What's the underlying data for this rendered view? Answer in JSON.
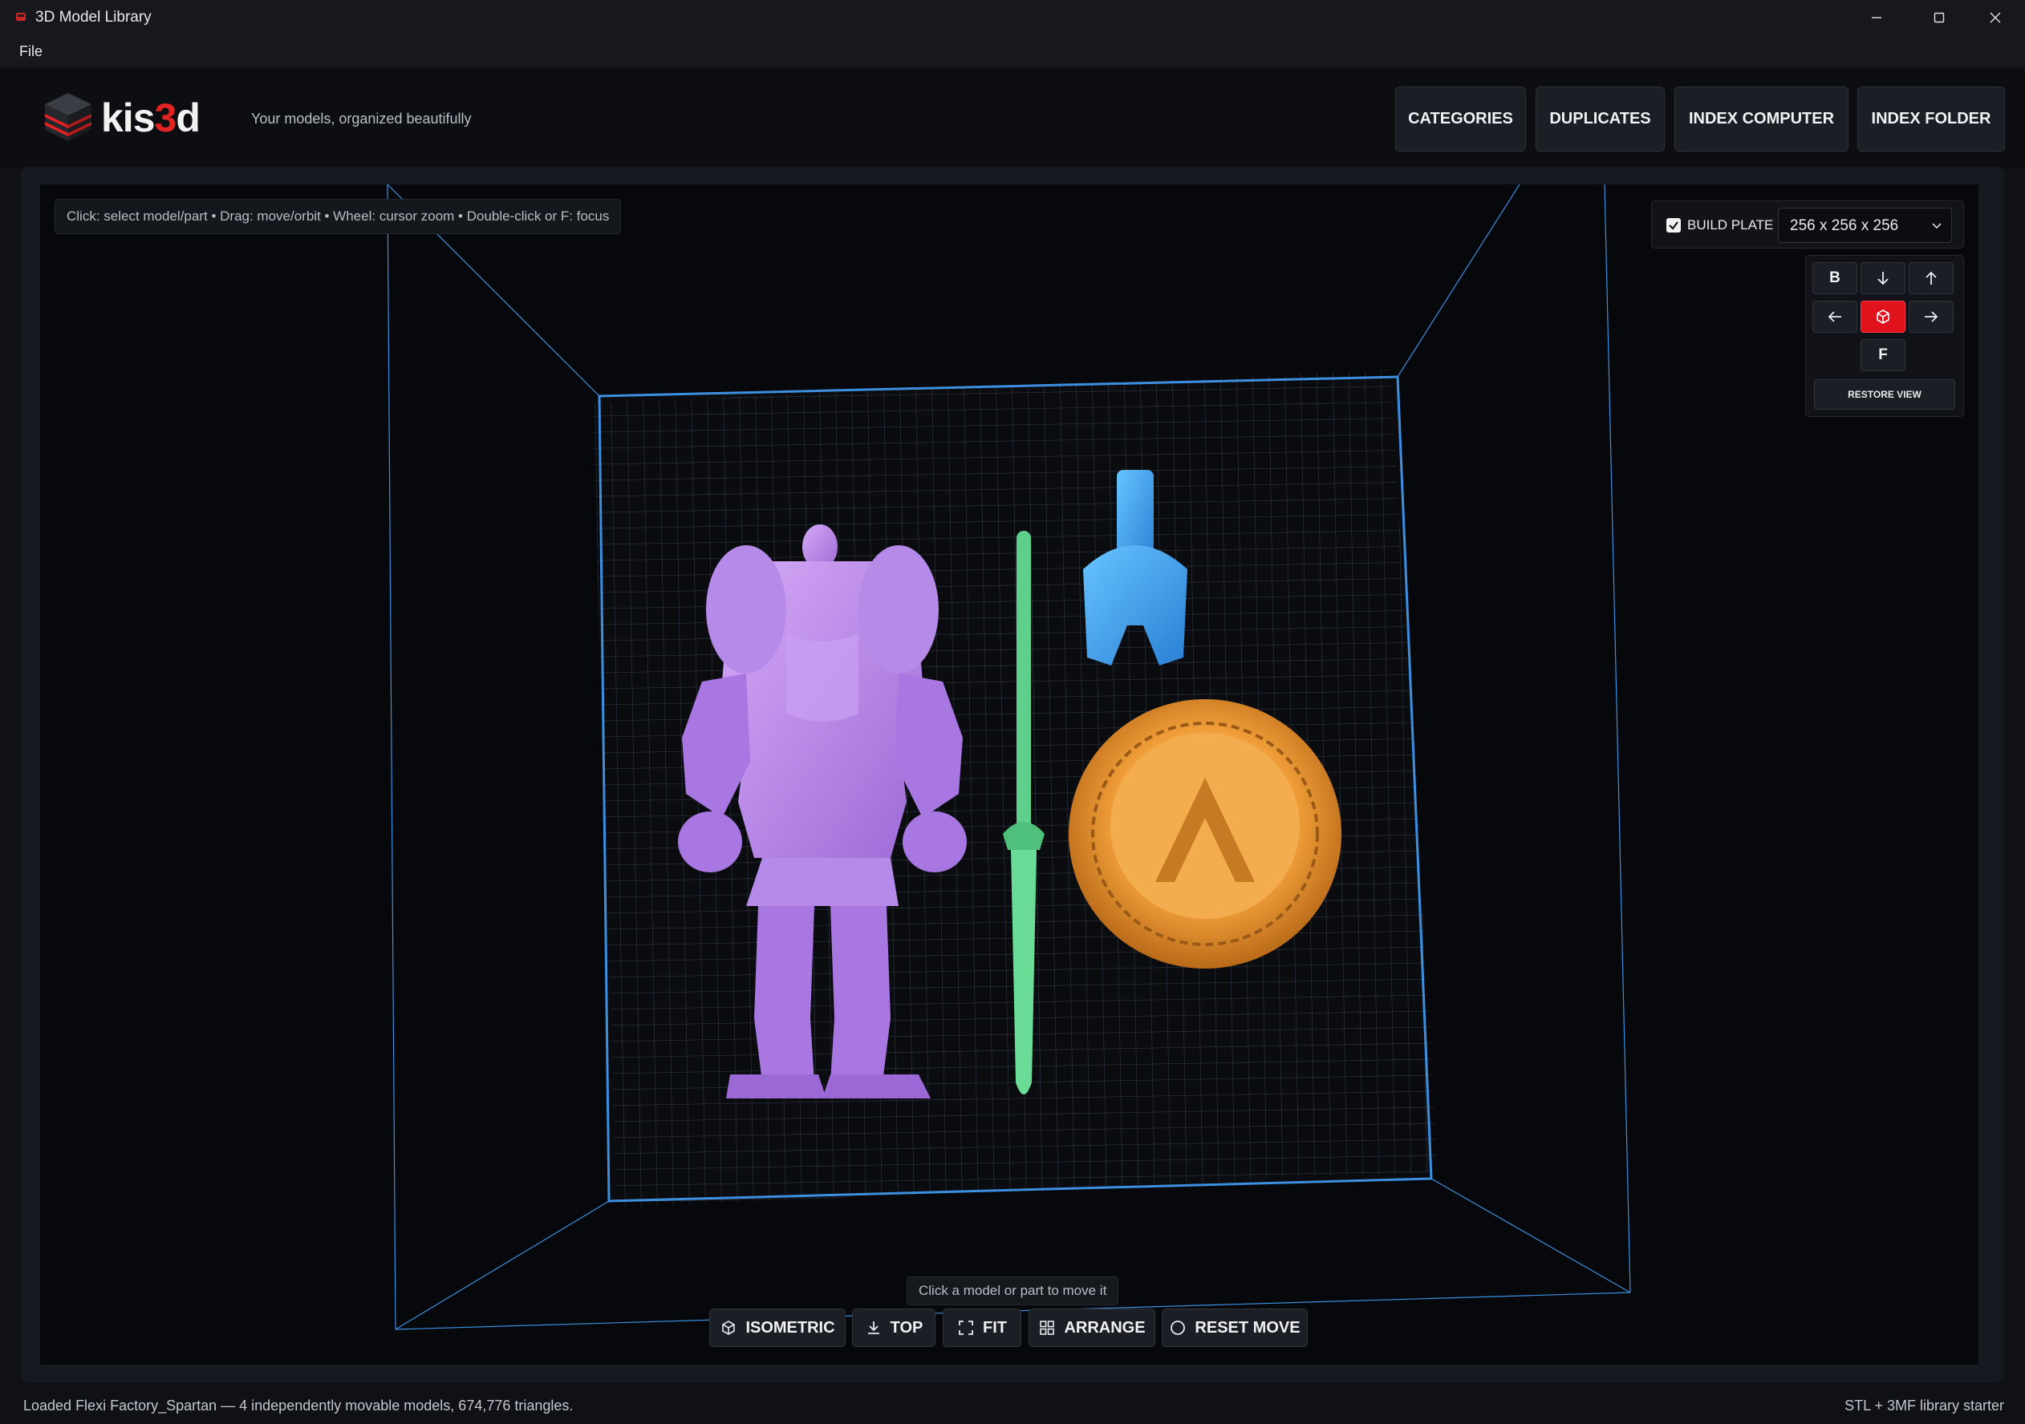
{
  "window": {
    "title": "3D Model Library",
    "controls": [
      "minimize",
      "maximize",
      "close"
    ]
  },
  "menu": {
    "file": "File"
  },
  "header": {
    "logo_text_left": "kis",
    "logo_text_accent": "3",
    "logo_text_right": "d",
    "tagline": "Your models, organized beautifully",
    "buttons": {
      "categories": "CATEGORIES",
      "duplicates": "DUPLICATES",
      "index_computer": "INDEX COMPUTER",
      "index_folder": "INDEX FOLDER"
    }
  },
  "viewport": {
    "hint": "Click: select model/part  •  Drag: move/orbit  •  Wheel: cursor zoom  •  Double-click or F: focus",
    "build_plate": {
      "checked": true,
      "label": "BUILD PLATE",
      "selected": "256 x 256 x 256"
    },
    "view_cube": {
      "back": "B",
      "front": "F",
      "restore": "RESTORE VIEW"
    },
    "move_hint": "Click a model or part to move it",
    "toolbar": {
      "isometric": "ISOMETRIC",
      "top": "TOP",
      "fit": "FIT",
      "arrange": "ARRANGE",
      "reset_move": "RESET MOVE"
    },
    "models": [
      {
        "name": "spartan-body",
        "color": "#b784e6"
      },
      {
        "name": "spartan-sword",
        "color": "#5fd08c"
      },
      {
        "name": "spartan-helmet",
        "color": "#3ea2ec"
      },
      {
        "name": "spartan-shield",
        "color": "#f0a13c"
      }
    ],
    "colors": {
      "grid_line": "#3a4250",
      "plate_edge": "#3d8fe0",
      "active": "#e0121c"
    }
  },
  "status": {
    "left": "Loaded Flexi Factory_Spartan — 4 independently movable models, 674,776 triangles.",
    "right": "STL + 3MF library starter"
  }
}
